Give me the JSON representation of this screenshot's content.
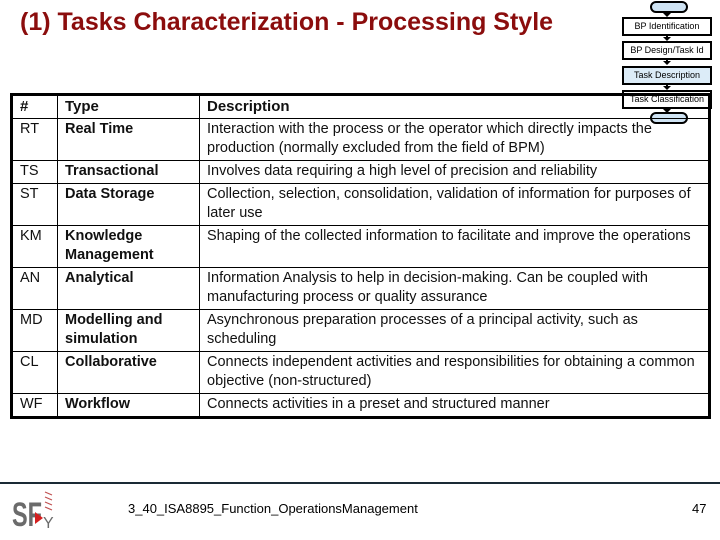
{
  "slide": {
    "title": "(1) Tasks Characterization - Processing Style",
    "title_color": "#8b0d0d"
  },
  "flowchart": {
    "steps": [
      {
        "label": "BP Identification",
        "highlighted": false
      },
      {
        "label": "BP Design/Task Id",
        "highlighted": false
      },
      {
        "label": "Task Description",
        "highlighted": true
      },
      {
        "label": "Task Classification",
        "highlighted": false
      }
    ],
    "highlight_color": "#dcecf8"
  },
  "table": {
    "headers": [
      "#",
      "Type",
      "Description"
    ],
    "rows": [
      {
        "code": "RT",
        "type": "Real Time",
        "description": "Interaction with the process or the operator which directly impacts the production (normally excluded from the field of BPM)"
      },
      {
        "code": "TS",
        "type": "Transactional",
        "description": "Involves data requiring a high level of precision and reliability"
      },
      {
        "code": "ST",
        "type": "Data Storage",
        "description": "Collection, selection, consolidation, validation of information for purposes of later use"
      },
      {
        "code": "KM",
        "type": "Knowledge Management",
        "description": "Shaping of the collected information to facilitate and improve the operations"
      },
      {
        "code": "AN",
        "type": "Analytical",
        "description": "Information Analysis to help in decision-making. Can be coupled with manufacturing process or quality assurance"
      },
      {
        "code": "MD",
        "type": "Modelling and simulation",
        "description": "Asynchronous preparation processes of a principal activity, such as scheduling"
      },
      {
        "code": "CL",
        "type": "Collaborative",
        "description": "Connects  independent activities and responsibilities for obtaining a common objective (non-structured)"
      },
      {
        "code": "WF",
        "type": "Workflow",
        "description": "Connects activities in a preset and structured manner"
      }
    ]
  },
  "footer": {
    "logo": "sfy-logo",
    "filename": "3_40_ISA8895_Function_OperationsManagement",
    "page_number": "47"
  }
}
